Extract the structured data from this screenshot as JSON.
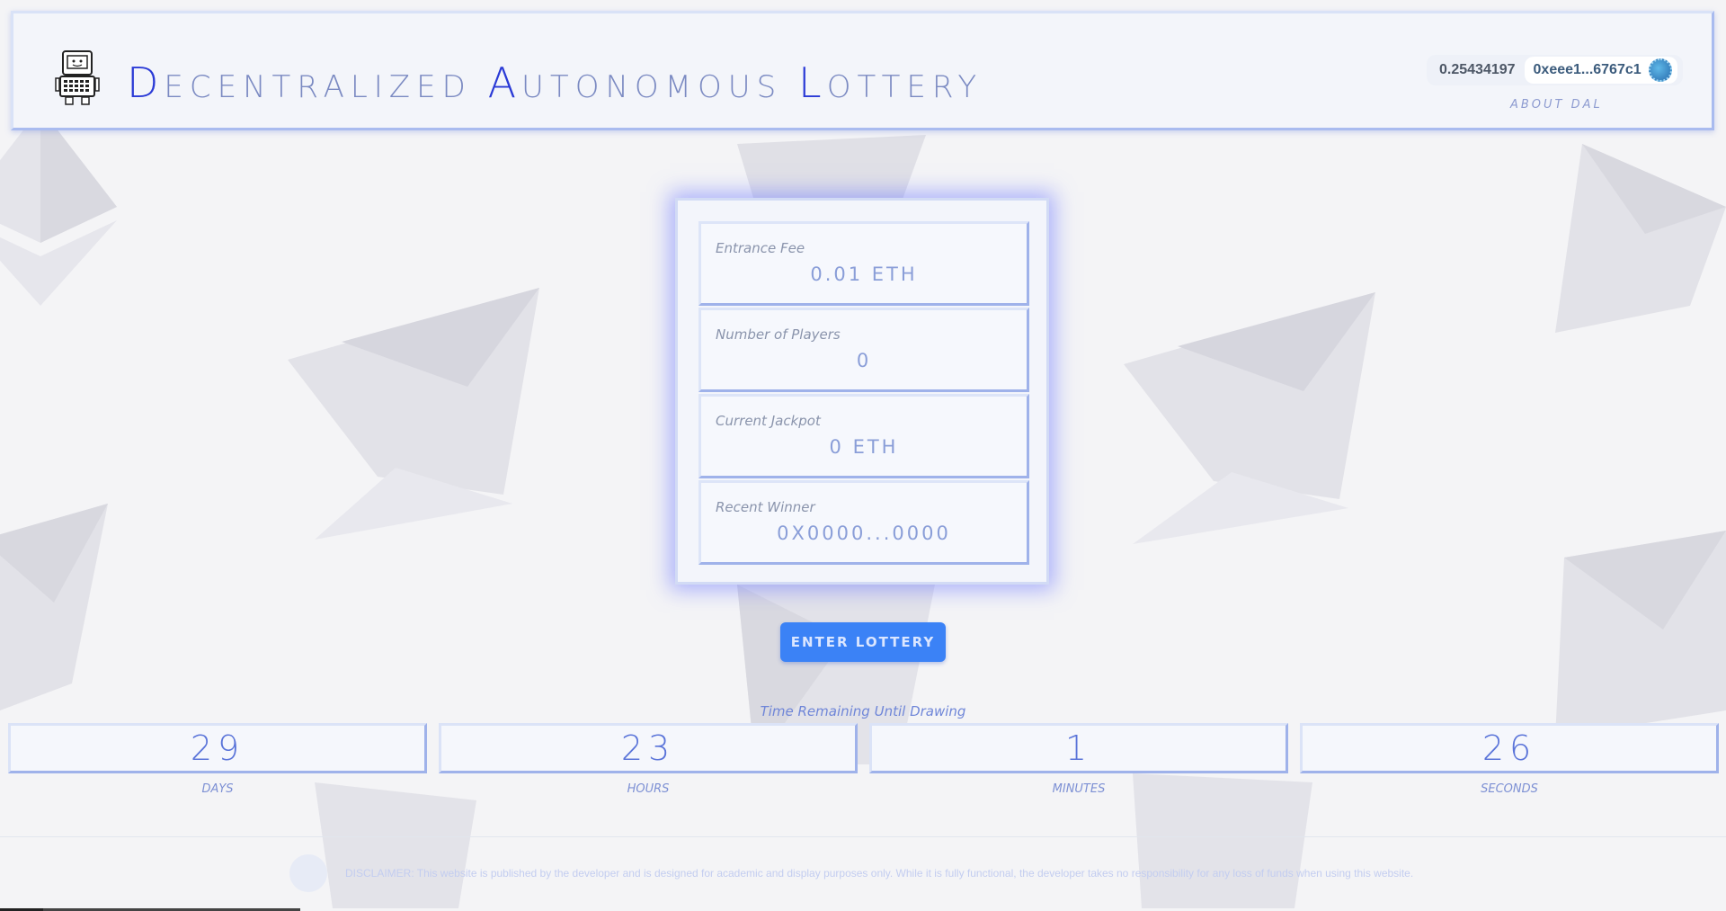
{
  "header": {
    "title_words": [
      {
        "cap": "D",
        "rest": "ECENTRALIZED"
      },
      {
        "cap": "A",
        "rest": "UTONOMOUS"
      },
      {
        "cap": "L",
        "rest": "OTTERY"
      }
    ],
    "balance": "0.25434197",
    "address": "0xeee1...6767c1",
    "about_label": "ABOUT DAL"
  },
  "stats": [
    {
      "label": "Entrance Fee",
      "value": "0.01 ETH"
    },
    {
      "label": "Number of Players",
      "value": "0"
    },
    {
      "label": "Current Jackpot",
      "value": "0 ETH"
    },
    {
      "label": "Recent Winner",
      "value": "0X0000...0000"
    }
  ],
  "enter_button": "ENTER LOTTERY",
  "timer": {
    "label": "Time Remaining Until Drawing",
    "units": [
      {
        "value": "29",
        "caption": "DAYS"
      },
      {
        "value": "23",
        "caption": "HOURS"
      },
      {
        "value": "1",
        "caption": "MINUTES"
      },
      {
        "value": "26",
        "caption": "SECONDS"
      }
    ]
  },
  "footer": {
    "disclaimer": "DISCLAIMER: This website is published by the developer and is designed for academic and display purposes only. While it is fully functional, the developer takes no responsibility for any loss of funds when using this website."
  },
  "colors": {
    "accent": "#3b82f6",
    "title_cap": "#2a3ad6",
    "card_glow": "#6e78ff"
  },
  "icons": [
    "robot-icon",
    "wallet-avatar-icon",
    "ethereum-background-icon",
    "footer-logo-icon"
  ]
}
